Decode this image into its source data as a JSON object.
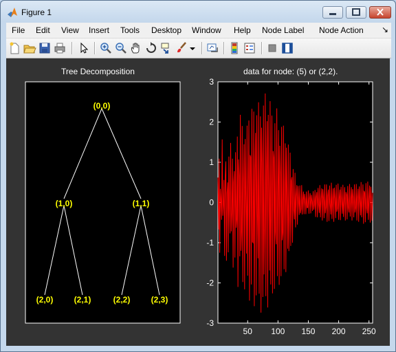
{
  "window": {
    "title": "Figure 1"
  },
  "menu": [
    "File",
    "Edit",
    "View",
    "Insert",
    "Tools",
    "Desktop",
    "Window",
    "Help",
    "Node Label",
    "Node Action"
  ],
  "toolbar": {
    "icons": [
      "new-figure-icon",
      "open-file-icon",
      "save-icon",
      "print-icon",
      "select-arrow-icon",
      "zoom-in-icon",
      "zoom-out-icon",
      "pan-hand-icon",
      "rotate-3d-icon",
      "data-cursor-icon",
      "brush-icon",
      "brush-dropdown-icon",
      "link-plot-icon",
      "colorbar-icon",
      "legend-icon",
      "hide-plot-tools-icon",
      "show-plot-tools-icon"
    ]
  },
  "colors": {
    "tree_lines": "#ffffff",
    "node_labels": "#ffff00",
    "signal": "#ff0000",
    "figure_bg": "#333333",
    "axes_bg": "#000000"
  },
  "tree": {
    "title": "Tree Decomposition",
    "nodes": [
      {
        "label": "(0,0)"
      },
      {
        "label": "(1,0)"
      },
      {
        "label": "(1,1)"
      },
      {
        "label": "(2,0)"
      },
      {
        "label": "(2,1)"
      },
      {
        "label": "(2,2)"
      },
      {
        "label": "(2,3)"
      }
    ],
    "edges": [
      [
        "(0,0)",
        "(1,0)"
      ],
      [
        "(0,0)",
        "(1,1)"
      ],
      [
        "(1,0)",
        "(2,0)"
      ],
      [
        "(1,0)",
        "(2,1)"
      ],
      [
        "(1,1)",
        "(2,2)"
      ],
      [
        "(1,1)",
        "(2,3)"
      ]
    ]
  },
  "chart_data": {
    "type": "line",
    "title": "data for node: (5) or (2,2).",
    "xlim": [
      1,
      256
    ],
    "ylim": [
      -3,
      3
    ],
    "xticks": [
      50,
      100,
      150,
      200,
      250
    ],
    "yticks": [
      3,
      2,
      1,
      0,
      -1,
      -2,
      -3
    ],
    "x": [
      1,
      256
    ],
    "series": [
      {
        "values": [
          0.62,
          -0.67,
          1.09,
          -1.25,
          0.34,
          0.06,
          -0.43,
          1.57,
          -0.33,
          -0.08,
          0.56,
          -1.33,
          0.65,
          1.02,
          -1.45,
          0.23,
          0.5,
          -1.24,
          1.14,
          -0.12,
          -0.77,
          1.48,
          -0.72,
          -0.26,
          1.09,
          -1.62,
          0.49,
          0.78,
          -1.37,
          1.25,
          -0.63,
          -0.42,
          1.64,
          -2.1,
          1.07,
          0.66,
          -1.34,
          2.18,
          -1.2,
          -0.71,
          1.9,
          -1.98,
          0.58,
          1.45,
          -2.16,
          1.58,
          0.07,
          -1.27,
          1.91,
          -1.82,
          0.25,
          2.04,
          -2.44,
          1.18,
          1.13,
          -2.04,
          2.33,
          -0.98,
          -1.0,
          2.26,
          -2.58,
          0.82,
          1.73,
          -2.31,
          2.17,
          -0.26,
          -1.39,
          2.49,
          -2.27,
          0.37,
          2.14,
          -2.74,
          1.86,
          0.99,
          -2.35,
          2.41,
          -1.79,
          -0.64,
          2.71,
          -2.33,
          0.73,
          2.02,
          -2.61,
          2.18,
          0.25,
          -1.69,
          2.52,
          -2.04,
          -0.2,
          2.16,
          -2.26,
          1.28,
          1.11,
          -2.15,
          1.97,
          -0.73,
          -1.04,
          2.34,
          -1.83,
          0.39,
          1.8,
          -2.05,
          1.41,
          0.68,
          -1.83,
          1.88,
          -0.94,
          -0.75,
          1.91,
          -1.66,
          0.37,
          1.47,
          -1.73,
          1.36,
          0.17,
          -1.15,
          1.44,
          -1.21,
          -0.26,
          1.24,
          -1.08,
          0.54,
          0.63,
          -1.0,
          0.83,
          -0.17,
          -0.42,
          0.74,
          -0.62,
          0.16,
          0.43,
          -0.55,
          0.41,
          0.04,
          -0.31,
          0.42,
          -0.27,
          -0.16,
          0.43,
          -0.3,
          0.07,
          0.27,
          -0.29,
          0.21,
          0.06,
          -0.29,
          0.27,
          -0.13,
          -0.13,
          0.3,
          -0.28,
          0.08,
          0.23,
          -0.27,
          0.19,
          0.02,
          -0.21,
          0.28,
          -0.18,
          -0.06,
          0.31,
          -0.36,
          0.13,
          0.26,
          -0.37,
          0.36,
          -0.05,
          -0.26,
          0.43,
          -0.37,
          0.1,
          0.35,
          -0.45,
          0.33,
          0.11,
          -0.39,
          0.45,
          -0.27,
          -0.12,
          0.45,
          -0.48,
          0.17,
          0.32,
          -0.46,
          0.42,
          -0.02,
          -0.3,
          0.49,
          -0.41,
          0.09,
          0.35,
          -0.48,
          0.37,
          0.1,
          -0.39,
          0.44,
          -0.23,
          -0.15,
          0.47,
          -0.43,
          0.12,
          0.32,
          -0.44,
          0.39,
          0.02,
          -0.28,
          0.44,
          -0.36,
          0.01,
          0.38,
          -0.45,
          0.26,
          0.19,
          -0.42,
          0.41,
          -0.12,
          -0.25,
          0.46,
          -0.35,
          0.06,
          0.38,
          -0.45,
          0.33,
          0.11,
          -0.37,
          0.45,
          -0.25,
          -0.13,
          0.46,
          -0.45,
          0.11,
          0.34,
          -0.48,
          0.4,
          0.04,
          -0.32,
          0.51,
          -0.37,
          0.0,
          0.45,
          -0.53,
          0.29,
          0.24,
          -0.49,
          0.48,
          -0.13,
          -0.27,
          0.52,
          -0.43,
          0.08,
          0.42,
          -0.5,
          0.39,
          0.12,
          -0.45,
          0.24
        ]
      }
    ]
  }
}
